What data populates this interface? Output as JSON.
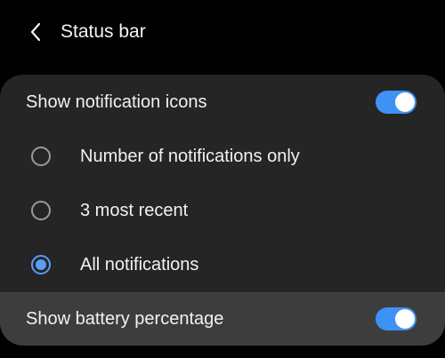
{
  "header": {
    "back_icon": "chevron-left-icon",
    "title": "Status bar"
  },
  "notifications": {
    "label": "Show notification icons",
    "enabled": true,
    "options": [
      {
        "label": "Number of notifications only",
        "selected": false
      },
      {
        "label": "3 most recent",
        "selected": false
      },
      {
        "label": "All notifications",
        "selected": true
      }
    ]
  },
  "battery": {
    "label": "Show battery percentage",
    "enabled": true
  },
  "colors": {
    "background": "#010101",
    "card": "#252525",
    "accent": "#3e91f5"
  }
}
